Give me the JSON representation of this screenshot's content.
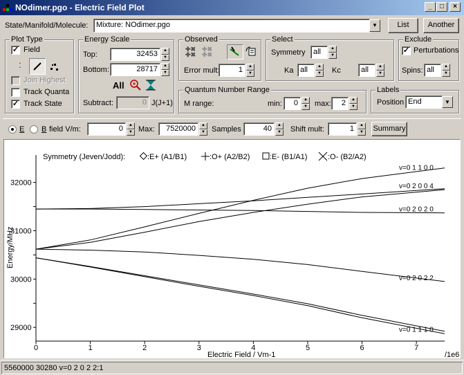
{
  "window": {
    "title": "NOdimer.pgo - Electric Field Plot"
  },
  "state": {
    "label": "State/Manifold/Molecule:",
    "value": "Mixture: NOdimer.pgo",
    "list_button": "List",
    "another_button": "Another"
  },
  "plot_type": {
    "title": "Plot Type",
    "field_label": "Field",
    "field_checked": "✓",
    "join_highest": "Join Highest",
    "track_quanta": "Track Quanta",
    "track_state": "Track State",
    "track_state_checked": "✓"
  },
  "energy_scale": {
    "title": "Energy Scale",
    "top_label": "Top:",
    "top_value": "32453",
    "bottom_label": "Bottom:",
    "bottom_value": "28717",
    "all_label": "All",
    "subtract_label": "Subtract:",
    "subtract_value": "0",
    "subtract_unit": "J(J+1)"
  },
  "observed": {
    "title": "Observed",
    "error_mult_label": "Error mult:",
    "error_mult_value": "1"
  },
  "select": {
    "title": "Select",
    "symmetry_label": "Symmetry",
    "symmetry_value": "all",
    "ka_label": "Ka",
    "ka_value": "all",
    "kc_label": "Kc",
    "kc_value": "all"
  },
  "exclude": {
    "title": "Exclude",
    "perturbations_label": "Perturbations",
    "perturbations_checked": "✓",
    "spins_label": "Spins:",
    "spins_value": "all"
  },
  "quantum_range": {
    "title": "Quantum Number Range",
    "m_range_label": "M range:",
    "min_label": "min:",
    "min_value": "0",
    "max_label": "max:",
    "max_value": "2"
  },
  "labels": {
    "title": "Labels",
    "position_label": "Position",
    "position_value": "End"
  },
  "field_bar": {
    "e_label": "E",
    "b_label": "B",
    "field_label": "field V/m:",
    "field_value": "0",
    "max_label": "Max:",
    "max_value": "7520000",
    "samples_label": "Samples",
    "samples_value": "40",
    "shift_label": "Shift mult:",
    "shift_value": "1",
    "summary_button": "Summary"
  },
  "legend": {
    "caption": "Symmetry (Jeven/Jodd):",
    "items": [
      ":E+ (A1/B1)",
      ":O+ (A2/B2)",
      ":E- (B1/A1)",
      ":O- (B2/A2)"
    ]
  },
  "chart_data": {
    "type": "line",
    "xlabel": "Electric Field / Vm-1",
    "ylabel": "Energy/MHz",
    "x_multiplier_label": "/1e6",
    "xlim": [
      0,
      7.52
    ],
    "ylim": [
      28717,
      32453
    ],
    "x_ticks": [
      0,
      1,
      2,
      3,
      4,
      5,
      6,
      7
    ],
    "y_ticks": [
      29000,
      29500,
      30000,
      30500,
      31000,
      31500,
      32000
    ],
    "y_tick_labels": [
      "29000",
      "",
      "30000",
      "",
      "31000",
      "",
      "32000"
    ],
    "series": [
      {
        "x": [
          0,
          1,
          2,
          3,
          4,
          5,
          6,
          7.52
        ],
        "y": [
          30620,
          30810,
          31080,
          31360,
          31630,
          31880,
          32080,
          32300
        ]
      },
      {
        "x": [
          0,
          1,
          2,
          3,
          4,
          5,
          6,
          7.52
        ],
        "y": [
          30620,
          30760,
          30970,
          31190,
          31380,
          31550,
          31700,
          31850
        ]
      },
      {
        "x": [
          0,
          1,
          2,
          3,
          4,
          5,
          6,
          7.52
        ],
        "y": [
          31450,
          31460,
          31500,
          31560,
          31620,
          31690,
          31760,
          31870
        ]
      },
      {
        "x": [
          0,
          1,
          2,
          3,
          4,
          5,
          6,
          7.52
        ],
        "y": [
          31450,
          31450,
          31440,
          31430,
          31420,
          31400,
          31380,
          31370
        ]
      },
      {
        "x": [
          0,
          1,
          2,
          3,
          4,
          5,
          6,
          7.52
        ],
        "y": [
          30620,
          30600,
          30560,
          30490,
          30410,
          30300,
          30160,
          29950
        ]
      },
      {
        "x": [
          0,
          1,
          2,
          3,
          4,
          5,
          6,
          7.52
        ],
        "y": [
          30440,
          30250,
          30050,
          29850,
          29660,
          29450,
          29200,
          28870
        ]
      },
      {
        "x": [
          0,
          1,
          2,
          3,
          4,
          5,
          6,
          7.52
        ],
        "y": [
          30440,
          30260,
          30070,
          29880,
          29690,
          29490,
          29250,
          28920
        ]
      }
    ],
    "annotations": [
      {
        "text": "v=0  1  1  0  0",
        "y": 32230
      },
      {
        "text": "v=0  2  0  0  4",
        "y": 31850
      },
      {
        "text": "v=0  2  0  2  0",
        "y": 31370
      },
      {
        "text": "v=0  2  0  2  2",
        "y": 29950
      },
      {
        "text": "v=0  1  1  1  0",
        "y": 28880
      }
    ]
  },
  "status": {
    "text": "5560000  30280 v=0  2  0  2  2:1"
  }
}
